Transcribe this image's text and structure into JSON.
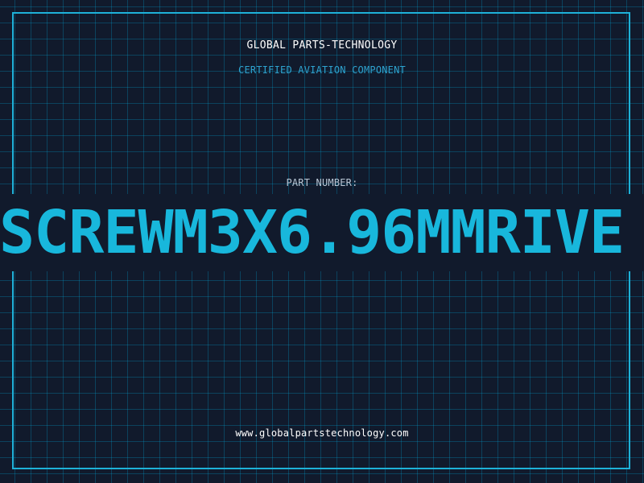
{
  "header": {
    "company_name": "GLOBAL PARTS-TECHNOLOGY",
    "subtitle": "CERTIFIED AVIATION COMPONENT"
  },
  "main": {
    "part_label": "PART NUMBER:",
    "part_number": "SCREWM3X6.96MMRIVE"
  },
  "footer": {
    "website": "www.globalpartstechnology.com"
  },
  "colors": {
    "background": "#111a2c",
    "accent": "#1eb1d8",
    "grid": "rgba(0,170,220,0.28)",
    "primary_text": "#ffffff",
    "secondary_text": "#2ea3cf",
    "label_text": "#b9c7d6"
  }
}
